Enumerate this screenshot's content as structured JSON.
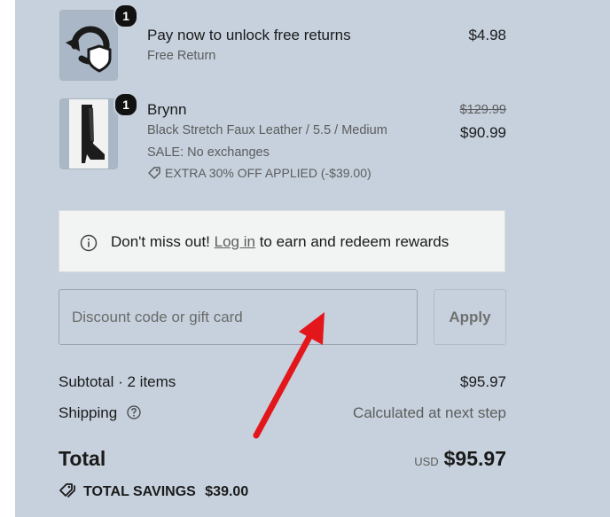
{
  "items": [
    {
      "quantity": "1",
      "name": "Pay now to unlock free returns",
      "subtitle": "Free Return",
      "price": "$4.98"
    },
    {
      "quantity": "1",
      "name": "Brynn",
      "variant": "Black Stretch Faux Leather / 5.5 / Medium",
      "sale_note": "SALE: No exchanges",
      "discount_tag": "EXTRA 30% OFF APPLIED (-$39.00)",
      "original_price": "$129.99",
      "price": "$90.99"
    }
  ],
  "notice": {
    "prefix": "Don't miss out!",
    "link": "Log in",
    "suffix": "to earn and redeem rewards"
  },
  "discount": {
    "placeholder": "Discount code or gift card",
    "apply_label": "Apply"
  },
  "summary": {
    "subtotal_label": "Subtotal · 2 items",
    "subtotal_value": "$95.97",
    "shipping_label": "Shipping",
    "shipping_value": "Calculated at next step",
    "total_label": "Total",
    "currency": "USD",
    "total_value": "$95.97",
    "savings_label": "TOTAL SAVINGS",
    "savings_value": "$39.00"
  },
  "colors": {
    "panel_bg": "#c6d1dd",
    "annotation_arrow": "#e3161b"
  }
}
